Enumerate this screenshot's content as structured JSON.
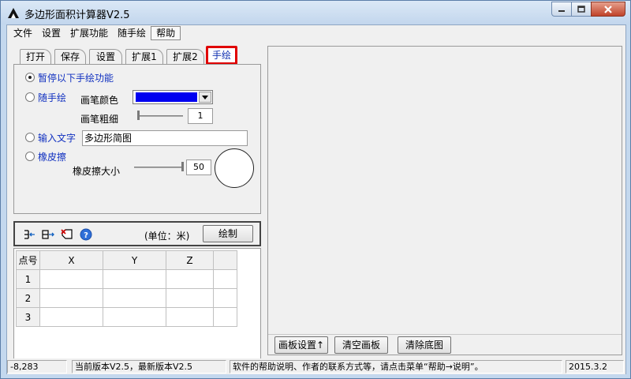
{
  "window": {
    "title": "多边形面积计算器V2.5"
  },
  "menu": [
    "文件",
    "设置",
    "扩展功能",
    "随手绘",
    "帮助"
  ],
  "tabs": [
    "打开",
    "保存",
    "设置",
    "扩展1",
    "扩展2",
    "手绘"
  ],
  "hand_draw": {
    "pause_label": "暂停以下手绘功能",
    "freehand_label": "随手绘",
    "pen_color_label": "画笔颜色",
    "pen_color": "#0000f0",
    "pen_width_label": "画笔粗细",
    "pen_width": "1",
    "text_label": "输入文字",
    "text_value": "多边形简图",
    "eraser_label": "橡皮擦",
    "eraser_size_label": "橡皮擦大小",
    "eraser_size": "50"
  },
  "toolbar": {
    "unit": "(单位：米)",
    "draw_button": "绘制"
  },
  "grid": {
    "headers": [
      "点号",
      "X",
      "Y",
      "Z",
      ""
    ],
    "rows": [
      "1",
      "2",
      "3"
    ]
  },
  "canvas": {
    "settings_button": "画板设置↑",
    "clear_button": "清空画板",
    "remove_bg_button": "清除底图"
  },
  "status": {
    "coords": "-8,283",
    "version": "当前版本V2.5，最新版本V2.5",
    "help": "软件的帮助说明、作者的联系方式等，请点击菜单“帮助→说明”。",
    "date": "2015.3.2"
  }
}
